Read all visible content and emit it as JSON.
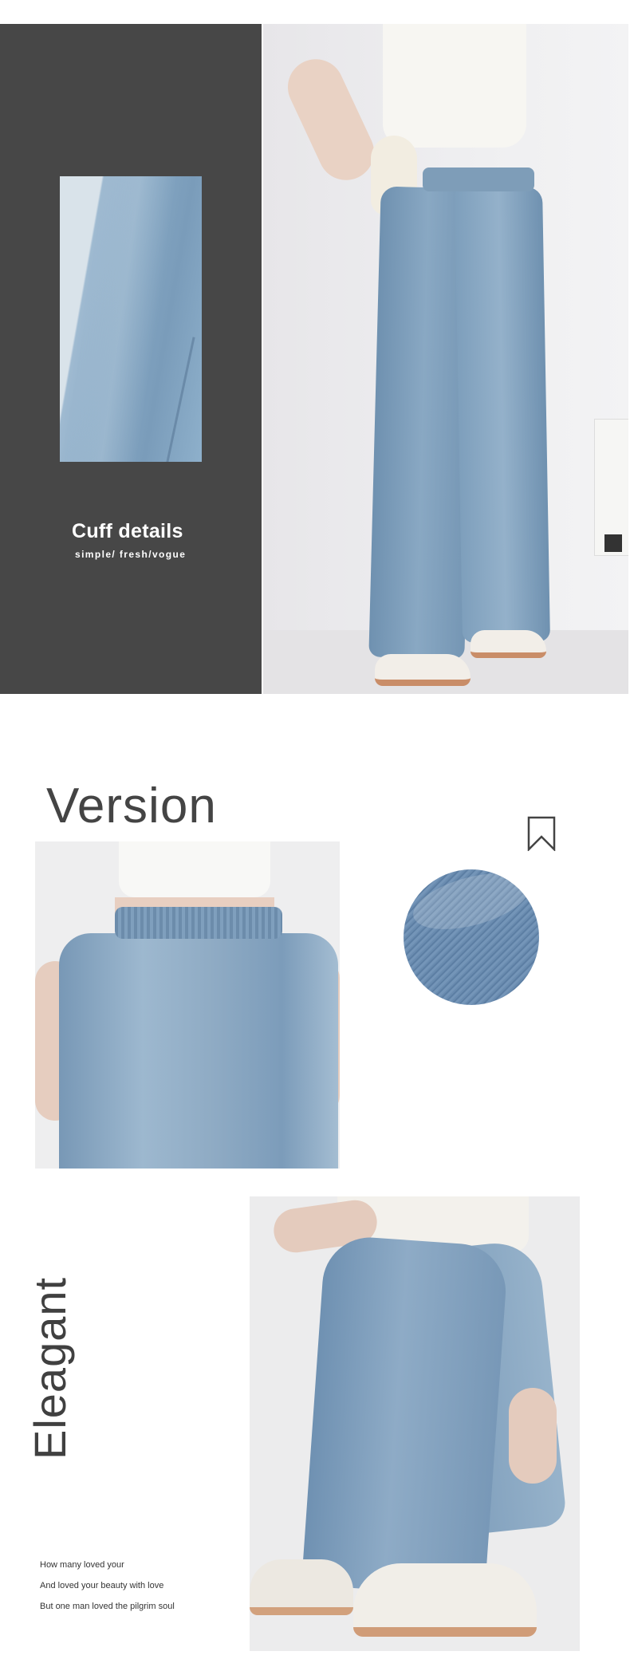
{
  "cuff": {
    "title": "Cuff details",
    "subtitle": "simple/ fresh/vogue",
    "panel_color": "#474747"
  },
  "version": {
    "title": "Version",
    "bookmark_icon": "bookmark-icon"
  },
  "elegant": {
    "title": "Eleagant",
    "poem": [
      "How many loved your",
      "And loved your beauty with love",
      "But one man loved the pilgrim soul"
    ]
  },
  "colors": {
    "denim": "#7c9dbb",
    "text_dark": "#444444"
  }
}
